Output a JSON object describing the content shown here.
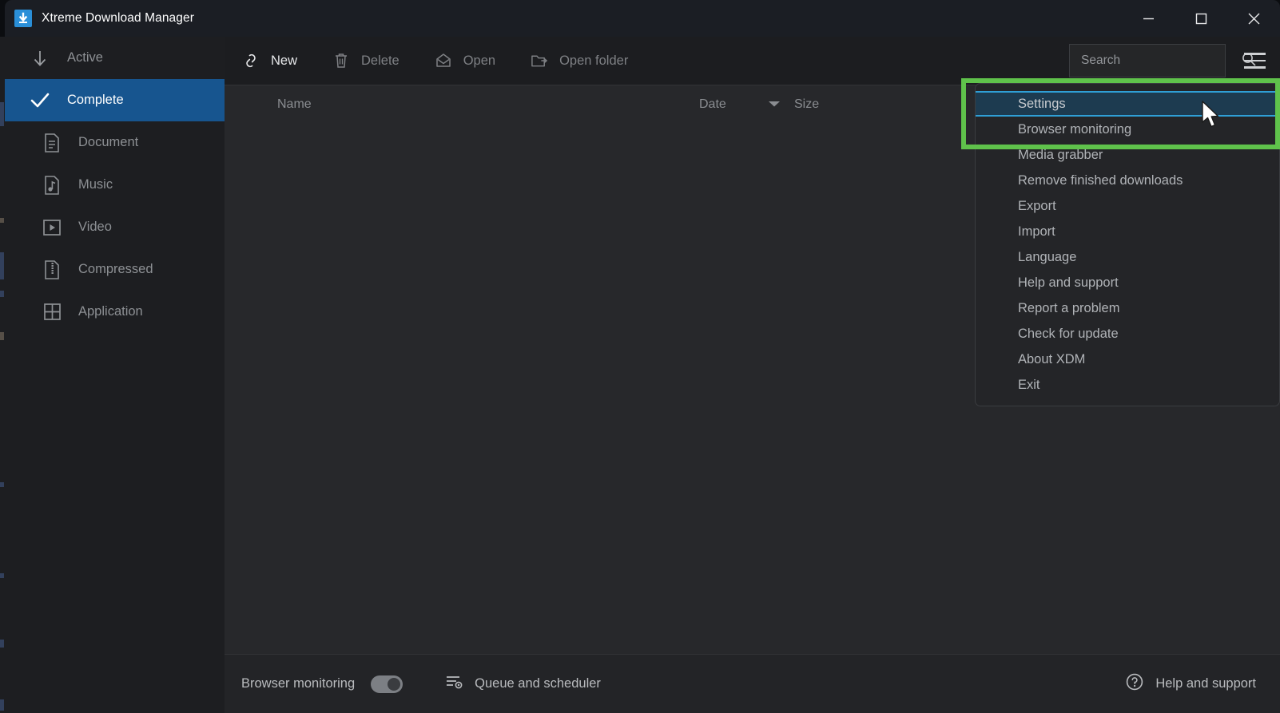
{
  "window": {
    "title": "Xtreme Download Manager",
    "app_icon": "download-arrow-icon",
    "controls": {
      "minimize": "minimize-icon",
      "maximize": "maximize-icon",
      "close": "close-icon"
    }
  },
  "sidebar": {
    "items": [
      {
        "label": "Active",
        "icon": "down-arrow-icon",
        "selected": false,
        "sub": false
      },
      {
        "label": "Complete",
        "icon": "check-icon",
        "selected": true,
        "sub": false
      },
      {
        "label": "Document",
        "icon": "document-icon",
        "selected": false,
        "sub": true
      },
      {
        "label": "Music",
        "icon": "music-note-icon",
        "selected": false,
        "sub": true
      },
      {
        "label": "Video",
        "icon": "play-icon",
        "selected": false,
        "sub": true
      },
      {
        "label": "Compressed",
        "icon": "archive-icon",
        "selected": false,
        "sub": true
      },
      {
        "label": "Application",
        "icon": "grid-icon",
        "selected": false,
        "sub": true
      }
    ]
  },
  "toolbar": {
    "new_label": "New",
    "delete_label": "Delete",
    "open_label": "Open",
    "open_folder_label": "Open folder",
    "icons": {
      "new": "link-icon",
      "delete": "trash-icon",
      "open": "envelope-open-icon",
      "open_folder": "folder-arrow-icon",
      "menu": "hamburger-icon"
    }
  },
  "search": {
    "placeholder": "Search",
    "value": "",
    "icon": "search-icon"
  },
  "columns": {
    "name": "Name",
    "date": "Date",
    "size": "Size",
    "sort_indicator": "chevron-down-icon"
  },
  "list": {
    "rows": []
  },
  "menu": {
    "items": [
      {
        "label": "Settings",
        "active": true
      },
      {
        "label": "Browser monitoring",
        "active": false
      },
      {
        "label": "Media grabber",
        "active": false
      },
      {
        "label": "Remove finished downloads",
        "active": false
      },
      {
        "label": "Export",
        "active": false
      },
      {
        "label": "Import",
        "active": false
      },
      {
        "label": "Language",
        "active": false
      },
      {
        "label": "Help and support",
        "active": false
      },
      {
        "label": "Report a problem",
        "active": false
      },
      {
        "label": "Check for update",
        "active": false
      },
      {
        "label": "About XDM",
        "active": false
      },
      {
        "label": "Exit",
        "active": false
      }
    ]
  },
  "statusbar": {
    "browser_monitoring_label": "Browser monitoring",
    "browser_monitoring_enabled": true,
    "queue_label": "Queue and scheduler",
    "queue_icon": "queue-settings-icon",
    "help_label": "Help and support",
    "help_icon": "question-circle-icon"
  },
  "colors": {
    "accent_blue": "#17558f",
    "menu_highlight_bg": "#1d3b50",
    "menu_highlight_border": "#2f9fd6",
    "annotation_green": "#5fc24b",
    "window_bg": "#1d1e21",
    "content_bg": "#27282b",
    "toolbar_bg": "#1c1d20",
    "titlebar_bg": "#1b1e24"
  }
}
